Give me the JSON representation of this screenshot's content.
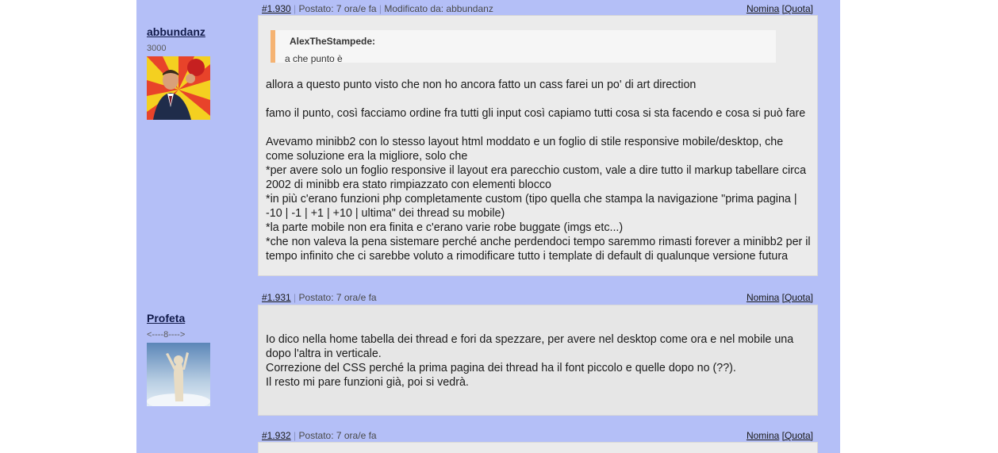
{
  "posts": [
    {
      "number": "#1.930",
      "posted": "Postato: 7 ora/e fa",
      "modified": "Modificato da: abbundanz",
      "nominate": "Nomina",
      "quote_action": "[Quota]",
      "author": {
        "name": "abbundanz",
        "rank": "3000"
      },
      "quote": {
        "author": "AlexTheStampede:",
        "text": "a che punto è"
      },
      "paragraphs": [
        "allora a questo punto visto che non ho ancora fatto un cass farei un po' di art direction",
        "famo il punto, così facciamo ordine fra tutti gli input così capiamo tutti cosa si sta facendo e cosa si può fare",
        "Avevamo minibb2 con lo stesso layout html moddato e un foglio di stile responsive mobile/desktop, che come soluzione era la migliore, solo che\n*per avere solo un foglio responsive il layout era parecchio custom, vale a dire tutto il markup tabellare circa 2002 di minibb era stato rimpiazzato con elementi blocco\n*in più c'erano funzioni php completamente custom (tipo quella che stampa la navigazione \"prima pagina | -10 | -1 | +1 | +10 | ultima\" dei thread su mobile)\n*la parte mobile non era finita e c'erano varie robe buggate (imgs etc...)\n*che non valeva la pena sistemare perché anche perdendoci tempo saremmo rimasti forever a minibb2 per il tempo infinito che ci sarebbe voluto a rimodificare tutto i template di default di qualunque versione futura"
      ]
    },
    {
      "number": "#1.931",
      "posted": "Postato: 7 ora/e fa",
      "nominate": "Nomina",
      "quote_action": "[Quota]",
      "author": {
        "name": "Profeta",
        "rank": "<----8---->"
      },
      "paragraphs": [
        "Io dico nella home tabella dei thread e fori da spezzare, per avere nel desktop come ora e nel mobile una dopo l'altra in verticale.\nCorrezione del CSS perché la prima pagina dei thread ha il font piccolo e quelle dopo no (??).\nIl resto mi pare funzioni già, poi si vedrà."
      ]
    },
    {
      "number": "#1.932",
      "posted": "Postato: 7 ora/e fa",
      "nominate": "Nomina",
      "quote_action": "[Quota]"
    }
  ]
}
